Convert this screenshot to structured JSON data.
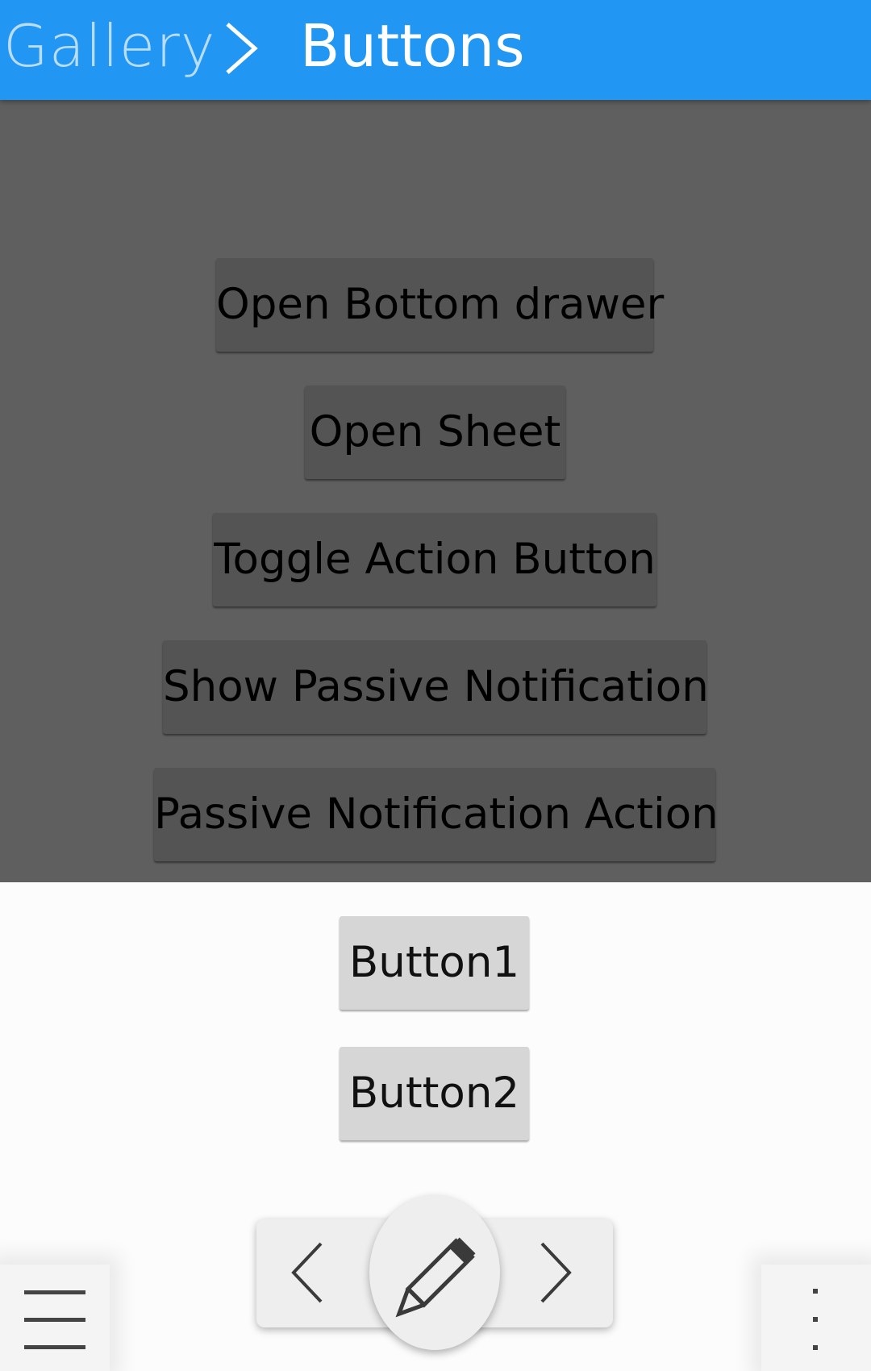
{
  "header": {
    "breadcrumb_previous": "Gallery",
    "breadcrumb_current": "Buttons"
  },
  "page_buttons": [
    "Open Bottom drawer",
    "Open Sheet",
    "Toggle Action Button",
    "Show Passive Notification",
    "Passive Notification Action"
  ],
  "drawer": {
    "button1": "Button1",
    "button2": "Button2"
  },
  "toolbar": {
    "left_icon": "chevron-left-icon",
    "main_icon": "pencil-icon",
    "right_icon": "chevron-right-icon",
    "global_drawer_icon": "hamburger-menu-icon",
    "context_drawer_icon": "overflow-menu-icon"
  },
  "colors": {
    "header": "#2196f3",
    "breadcrumb_previous": "#b9ddfb",
    "dim_overlay": "#5f5f5f",
    "drawer_background": "#fcfcfc"
  }
}
